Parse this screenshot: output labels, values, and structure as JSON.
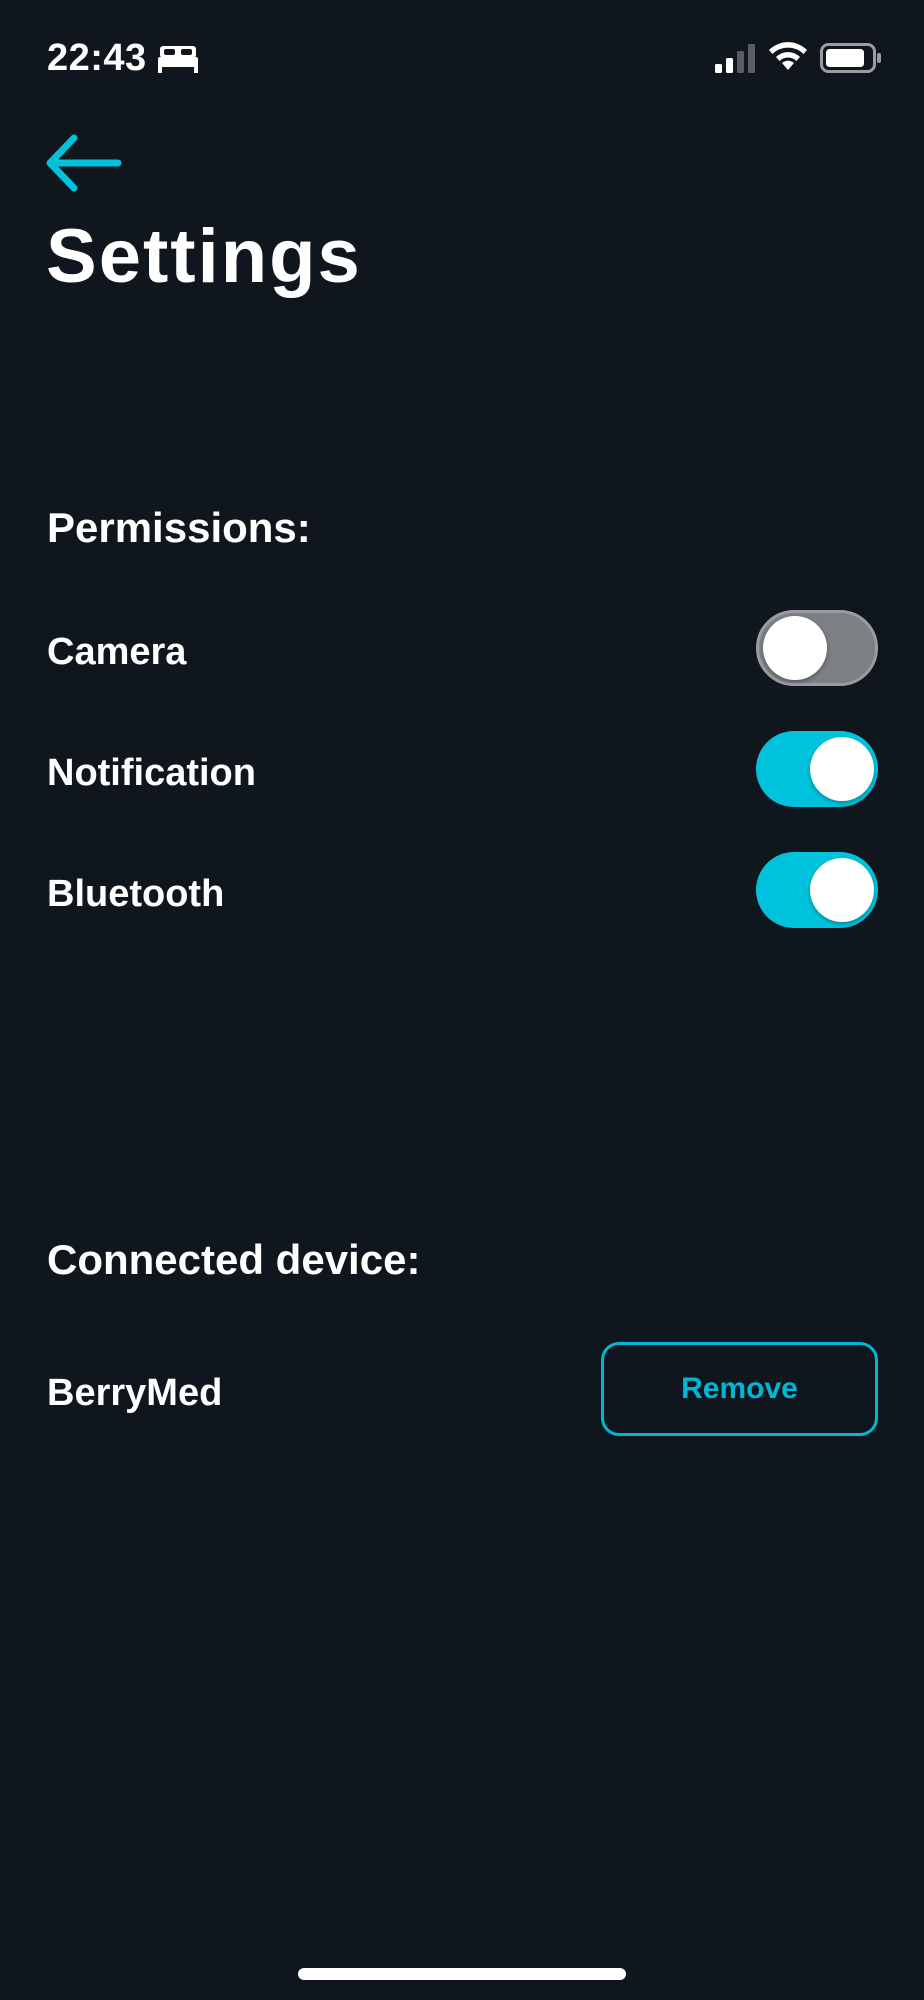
{
  "status_bar": {
    "time": "22:43",
    "icons": [
      "bed-icon",
      "signal-icon",
      "wifi-icon",
      "battery-icon"
    ]
  },
  "header": {
    "back_icon": "arrow-left-icon",
    "title": "Settings"
  },
  "permissions": {
    "heading": "Permissions:",
    "items": [
      {
        "label": "Camera",
        "enabled": false
      },
      {
        "label": "Notification",
        "enabled": true
      },
      {
        "label": "Bluetooth",
        "enabled": true
      }
    ]
  },
  "connected_device": {
    "heading": "Connected device:",
    "name": "BerryMed",
    "remove_label": "Remove"
  },
  "colors": {
    "background": "#10161e",
    "accent": "#00c2dc",
    "toggle_off": "#7c7f84",
    "text": "#ffffff"
  }
}
